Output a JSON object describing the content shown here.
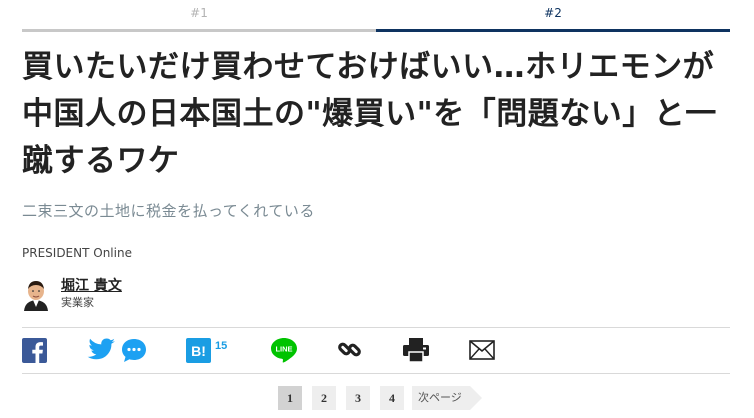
{
  "tabs": [
    {
      "label": "#1"
    },
    {
      "label": "#2"
    }
  ],
  "article": {
    "title": "買いたいだけ買わせておけばいい…ホリエモンが中国人の日本国土の\"爆買い\"を「問題ない」と一蹴するワケ",
    "subtitle": "二束三文の土地に税金を払ってくれている",
    "source": "PRESIDENT Online"
  },
  "author": {
    "name": "堀江 貴文",
    "role": "実業家"
  },
  "share": {
    "hatena_count": "15",
    "icons": [
      "facebook-icon",
      "twitter-icon",
      "comment-icon",
      "hatena-bookmark-icon",
      "line-icon",
      "link-icon",
      "print-icon",
      "mail-icon"
    ],
    "colors": {
      "facebook": "#3b5998",
      "twitter": "#1da1f2",
      "hatena": "#1a9de3",
      "line": "#00c300",
      "dark": "#222222"
    }
  },
  "pagination": {
    "pages": [
      "1",
      "2",
      "3",
      "4"
    ],
    "current": "1",
    "next_label": "次ページ"
  }
}
